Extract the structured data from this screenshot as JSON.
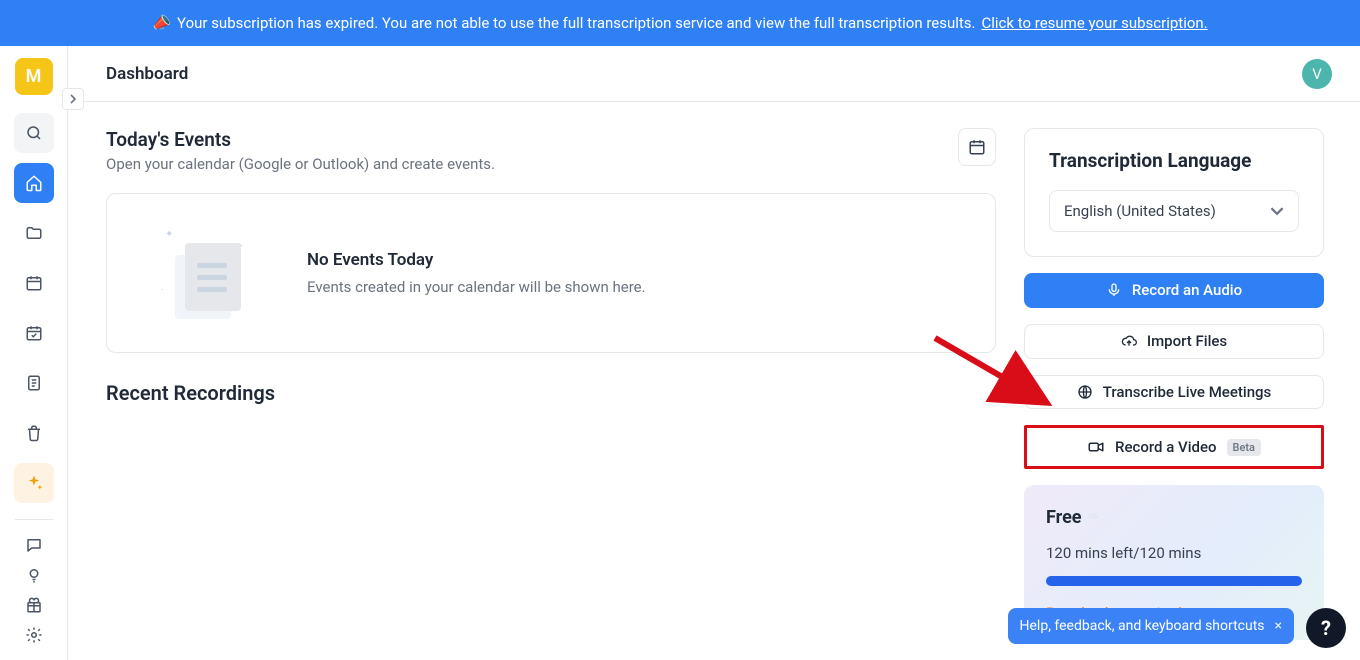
{
  "banner": {
    "icon": "📣",
    "text": "Your subscription has expired. You are not able to use the full transcription service and view the full transcription results.",
    "link_text": "Click to resume your subscription."
  },
  "sidebar": {
    "logo_letter": "M"
  },
  "header": {
    "title": "Dashboard",
    "avatar_letter": "V"
  },
  "events": {
    "title": "Today's Events",
    "subtitle": "Open your calendar (Google or Outlook) and create events.",
    "empty_title": "No Events Today",
    "empty_subtitle": "Events created in your calendar will be shown here."
  },
  "recent": {
    "title": "Recent Recordings"
  },
  "lang_panel": {
    "title": "Transcription Language",
    "selected": "English (United States)"
  },
  "actions": {
    "record_audio": "Record an Audio",
    "import_files": "Import Files",
    "transcribe_live": "Transcribe Live Meetings",
    "record_video": "Record a Video",
    "beta_label": "Beta"
  },
  "plan": {
    "name": "Free",
    "usage": "120 mins left/120 mins",
    "expired": "Pro plan has expired"
  },
  "help": {
    "text": "Help, feedback, and keyboard shortcuts",
    "close": "×",
    "question": "?"
  }
}
